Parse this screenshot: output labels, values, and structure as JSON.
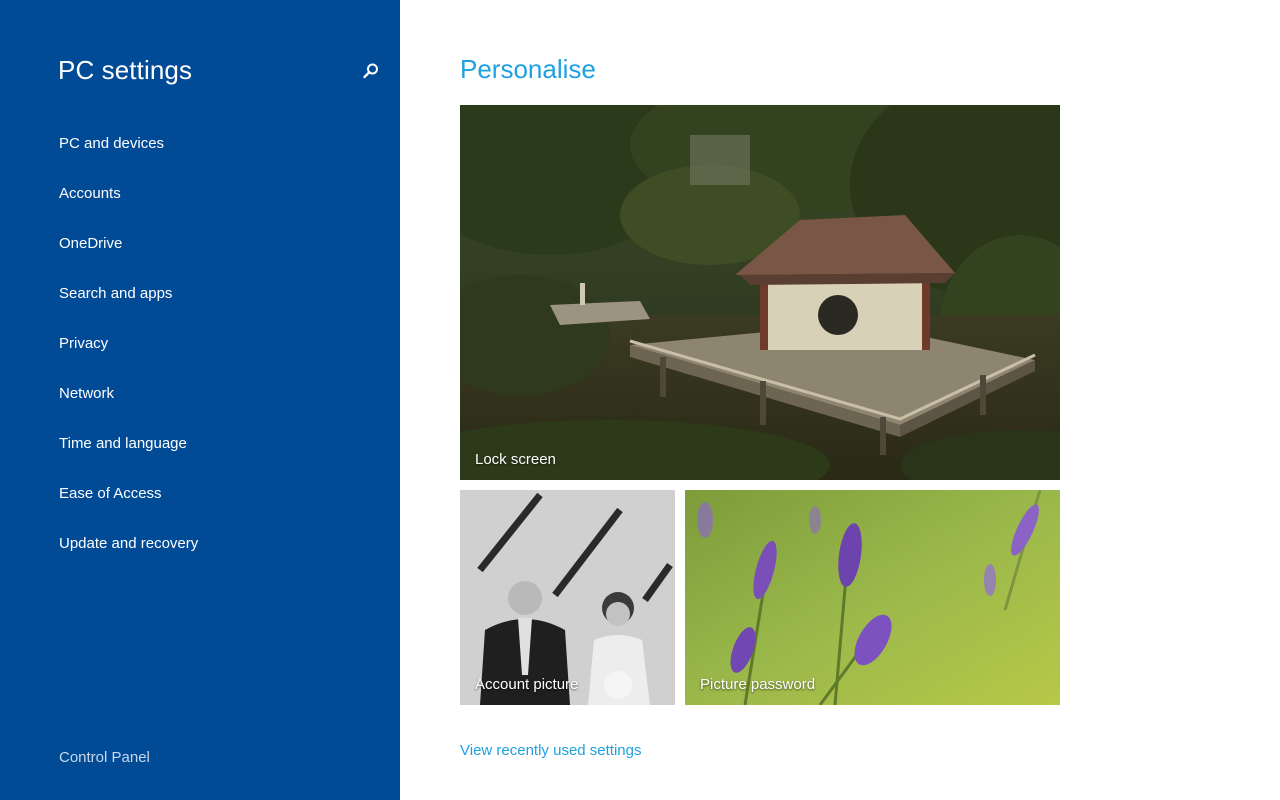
{
  "app": {
    "title": "PC settings"
  },
  "sidebar": {
    "search_icon": "search-icon",
    "items": [
      {
        "label": "PC and devices"
      },
      {
        "label": "Accounts"
      },
      {
        "label": "OneDrive"
      },
      {
        "label": "Search and apps"
      },
      {
        "label": "Privacy"
      },
      {
        "label": "Network"
      },
      {
        "label": "Time and language"
      },
      {
        "label": "Ease of Access"
      },
      {
        "label": "Update and recovery"
      }
    ],
    "footer_link": "Control Panel"
  },
  "main": {
    "title": "Personalise",
    "tiles": {
      "lock_screen": "Lock screen",
      "account_picture": "Account picture",
      "picture_password": "Picture password"
    },
    "recent_link": "View recently used settings"
  },
  "colors": {
    "sidebar_bg": "#004a96",
    "accent": "#1fa0e2",
    "text_on_sidebar": "#ffffff"
  }
}
